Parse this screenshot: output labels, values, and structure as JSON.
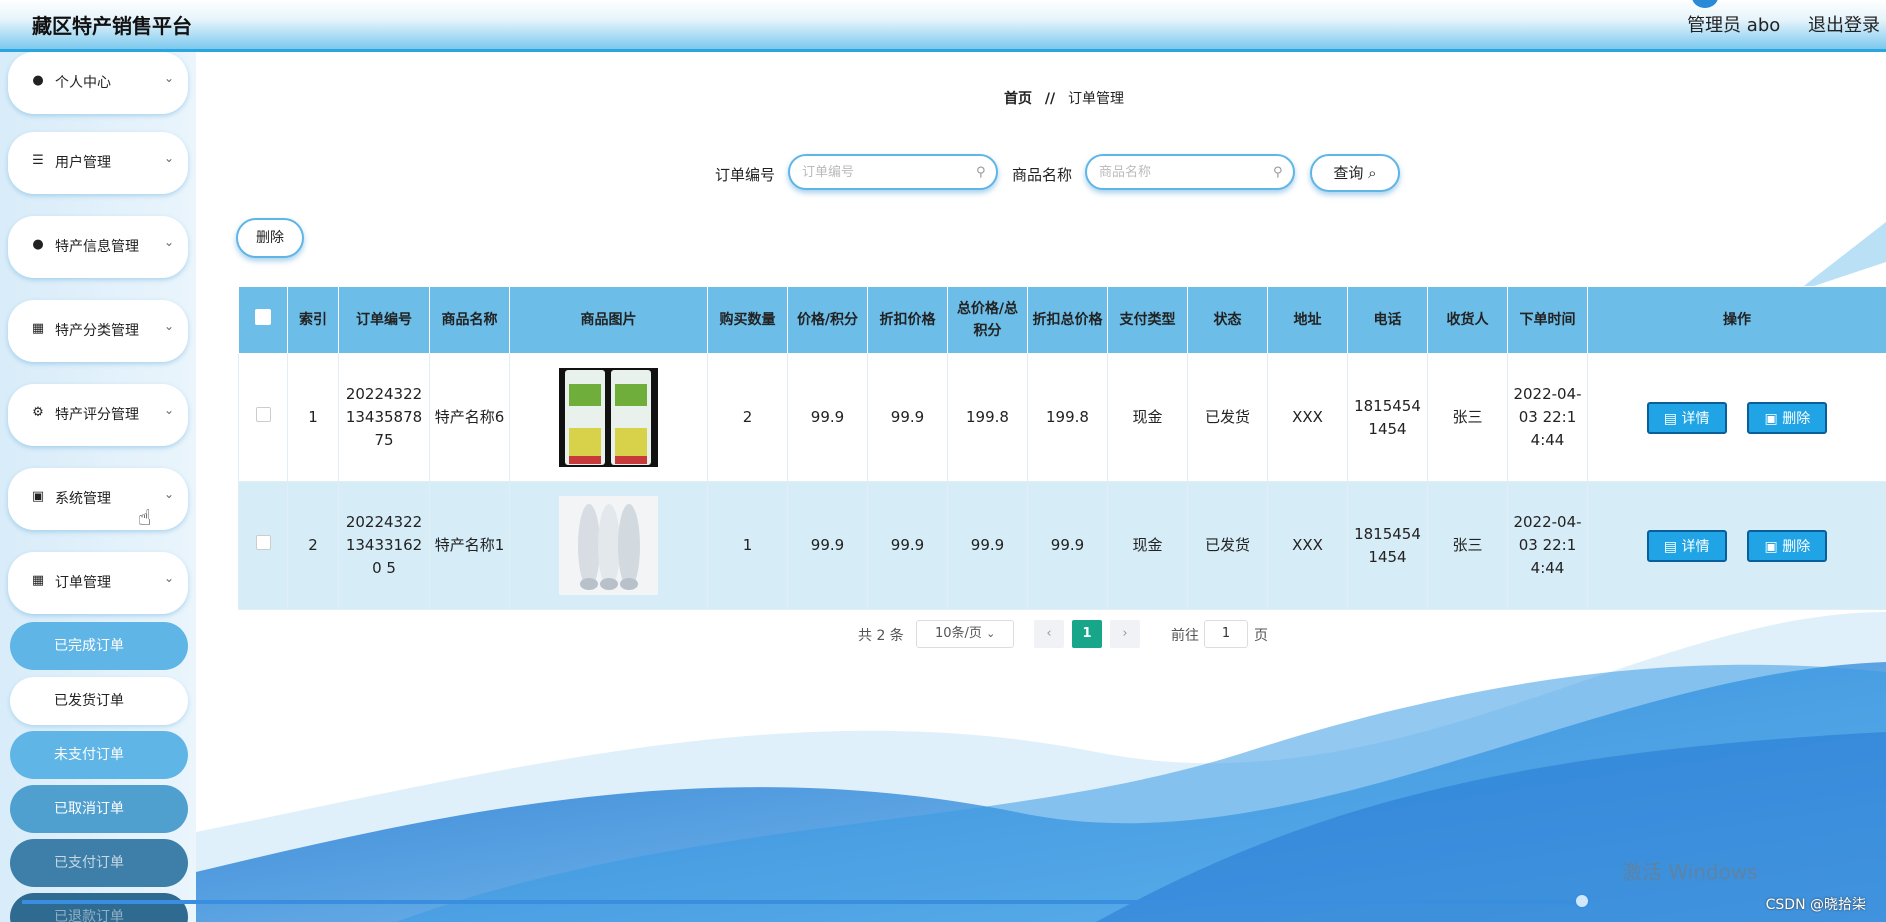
{
  "header": {
    "title": "藏区特产销售平台",
    "admin_label": "管理员 abo",
    "logout_label": "退出登录"
  },
  "sidebar": {
    "items": [
      {
        "label": "个人中心",
        "icon": "user-icon"
      },
      {
        "label": "用户管理",
        "icon": "list-icon"
      },
      {
        "label": "特产信息管理",
        "icon": "user-icon"
      },
      {
        "label": "特产分类管理",
        "icon": "grid-icon"
      },
      {
        "label": "特产评分管理",
        "icon": "sliders-icon"
      },
      {
        "label": "系统管理",
        "icon": "clipboard-icon"
      },
      {
        "label": "订单管理",
        "icon": "grid-icon"
      }
    ],
    "sub_items": [
      "已完成订单",
      "已发货订单",
      "未支付订单",
      "已取消订单",
      "已支付订单",
      "已退款订单"
    ]
  },
  "breadcrumb": {
    "home": "首页",
    "sep": "//",
    "current": "订单管理"
  },
  "search": {
    "order_no_label": "订单编号",
    "order_no_placeholder": "订单编号",
    "product_label": "商品名称",
    "product_placeholder": "商品名称",
    "query_label": "查询 ⌕"
  },
  "toolbar": {
    "delete_label": "删除"
  },
  "table": {
    "headers": [
      "索引",
      "订单编号",
      "商品名称",
      "商品图片",
      "购买数量",
      "价格/积分",
      "折扣价格",
      "总价格/总积分",
      "折扣总价格",
      "支付类型",
      "状态",
      "地址",
      "电话",
      "收货人",
      "下单时间",
      "操作"
    ],
    "rows": [
      {
        "index": "1",
        "order_no": "2022432213435878 75",
        "product": "特产名称6",
        "qty": "2",
        "price": "99.9",
        "discount": "99.9",
        "total": "199.8",
        "discount_total": "199.8",
        "pay_type": "现金",
        "status": "已发货",
        "address": "XXX",
        "phone": "1815454 1454",
        "receiver": "张三",
        "time": "2022-04-03 22:14:44",
        "detail_label": "详情",
        "delete_label": "删除"
      },
      {
        "index": "2",
        "order_no": "20224322134331620 5",
        "product": "特产名称1",
        "qty": "1",
        "price": "99.9",
        "discount": "99.9",
        "total": "99.9",
        "discount_total": "99.9",
        "pay_type": "现金",
        "status": "已发货",
        "address": "XXX",
        "phone": "1815454 1454",
        "receiver": "张三",
        "time": "2022-04-03 22:14:44",
        "detail_label": "详情",
        "delete_label": "删除"
      }
    ]
  },
  "pagination": {
    "total": "共 2 条",
    "page_size": "10条/页",
    "current_page": "1",
    "goto_label": "前往",
    "goto_value": "1",
    "page_suffix": "页"
  },
  "overlay": {
    "watermark": "激活 Windows",
    "csdn": "CSDN @晓拾柒"
  },
  "colors": {
    "accent": "#21a4e6",
    "header_row": "#6cbde8",
    "stripe": "#d6ecf7",
    "active_page": "#17a68a"
  }
}
